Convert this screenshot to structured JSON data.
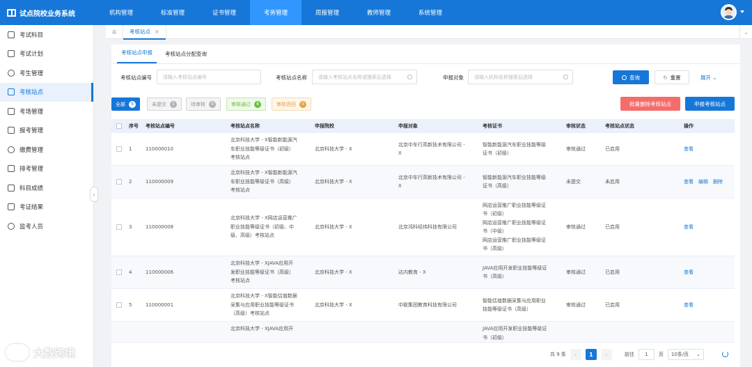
{
  "app": {
    "title": "试点院校业务系统"
  },
  "nav": [
    "机构管理",
    "标准管理",
    "证书管理",
    "考务管理",
    "周报管理",
    "教师管理",
    "系统管理"
  ],
  "nav_active": "考务管理",
  "sidebar": [
    {
      "label": "考试科目",
      "icon": "book-icon"
    },
    {
      "label": "考试计划",
      "icon": "calendar-icon"
    },
    {
      "label": "考生管理",
      "icon": "user-circle-icon"
    },
    {
      "label": "考核站点",
      "icon": "location-icon"
    },
    {
      "label": "考场管理",
      "icon": "grid-icon"
    },
    {
      "label": "报考管理",
      "icon": "document-icon"
    },
    {
      "label": "缴费管理",
      "icon": "currency-icon"
    },
    {
      "label": "排考管理",
      "icon": "schedule-icon"
    },
    {
      "label": "科目成绩",
      "icon": "score-icon"
    },
    {
      "label": "考证结果",
      "icon": "check-square-icon"
    },
    {
      "label": "监考人员",
      "icon": "people-icon"
    }
  ],
  "sidebar_active": "考核站点",
  "tabbar": {
    "page_tab": "考核站点",
    "close": "×"
  },
  "subtabs": [
    "考核站点申报",
    "考核站点分配查询"
  ],
  "filters": {
    "code_label": "考核站点编号",
    "code_placeholder": "请输入考核站点编号",
    "name_label": "考核站点名称",
    "name_placeholder": "请输入考核站点名称或搜索后选择",
    "target_label": "申报对象",
    "target_placeholder": "请输入机构名称搜索后选择",
    "search_btn": "查询",
    "reset_btn": "重置",
    "expand": "展开"
  },
  "chips": [
    {
      "label": "全部",
      "count": "9"
    },
    {
      "label": "未提交",
      "count": "1"
    },
    {
      "label": "待审核",
      "count": "0"
    },
    {
      "label": "审核通过",
      "count": "8"
    },
    {
      "label": "审核退回",
      "count": "0"
    }
  ],
  "actions": {
    "batch_delete": "批量删除考核站点",
    "apply": "申报考核站点"
  },
  "table": {
    "headers": [
      "序号",
      "考核站点编号",
      "考核站点名称",
      "申报院校",
      "申报对象",
      "考核证书",
      "审核状态",
      "考核站点状态",
      "操作"
    ],
    "rows": [
      {
        "no": "1",
        "code": "110000010",
        "name": [
          "北京科技大学 - X智能新能源汽",
          "车职业技能等级证书（初级）",
          "考核站点"
        ],
        "school": "北京科技大学 - X",
        "target": [
          "北京中车行高新技术有限公司 -",
          "X"
        ],
        "cert": [
          "智能新能源汽车职业技能等级",
          "证书（初级）"
        ],
        "audit": "审核通过",
        "status": "已启用",
        "ops": [
          "查看"
        ]
      },
      {
        "no": "2",
        "code": "110000009",
        "name": [
          "北京科技大学 - X智能新能源汽",
          "车职业技能等级证书（高级）",
          "考核站点"
        ],
        "school": "北京科技大学 - X",
        "target": [
          "北京中车行高新技术有限公司 -",
          "X"
        ],
        "cert": [
          "智能新能源汽车职业技能等级",
          "证书（高级）"
        ],
        "audit": "未提交",
        "status": "未启用",
        "ops": [
          "查看",
          "编辑",
          "删除"
        ]
      },
      {
        "no": "3",
        "code": "110000008",
        "name": [
          "北京科技大学 - X网店运营推广",
          "职业技能等级证书（初级、中",
          "级、高级）考核站点"
        ],
        "school": "北京科技大学 - X",
        "target": [
          "北京鸿科经纬科技有限公司"
        ],
        "cert": [
          "网店运营推广职业技能等级证",
          "书（初级）",
          "网店运营推广职业技能等级证",
          "书（中级）",
          "网店运营推广职业技能等级证",
          "书（高级）"
        ],
        "audit": "审核通过",
        "status": "已启用",
        "ops": [
          "查看"
        ]
      },
      {
        "no": "4",
        "code": "110000006",
        "name": [
          "北京科技大学 - XJAVA应用开",
          "发职业技能等级证书（高级）",
          "考核站点"
        ],
        "school": "北京科技大学 - X",
        "target": [
          "达内教育 - X"
        ],
        "cert": [
          "JAVA应用开发职业技能等级证",
          "书（高级）"
        ],
        "audit": "审核通过",
        "status": "已启用",
        "ops": [
          "查看"
        ]
      },
      {
        "no": "5",
        "code": "110000001",
        "name": [
          "北京科技大学 - X智能估值数据",
          "采集与应用职业技能等级证书",
          "（高级）考核站点"
        ],
        "school": "北京科技大学 - X",
        "target": [
          "中联集团教育科技有限公司"
        ],
        "cert": [
          "智能估值数据采集与应用职业",
          "技能等级证书（高级）"
        ],
        "audit": "审核通过",
        "status": "已启用",
        "ops": [
          "查看"
        ]
      },
      {
        "no": "",
        "code": "",
        "name": [
          "北京科技大学 - XJAVA应用开"
        ],
        "school": "",
        "target": [
          ""
        ],
        "cert": [
          "JAVA应用开发职业技能等级证",
          "书（初级）"
        ],
        "audit": "",
        "status": "",
        "ops": []
      }
    ]
  },
  "pagination": {
    "total": "共 9 条",
    "current": "1",
    "goto": "前往",
    "page_input": "1",
    "page_unit": "页",
    "page_size": "10条/页"
  },
  "watermark": "大数跨境",
  "colors": {
    "primary": "#1677d8",
    "danger": "#f56c6c",
    "success": "#67c23a",
    "warning": "#e6a23c"
  }
}
